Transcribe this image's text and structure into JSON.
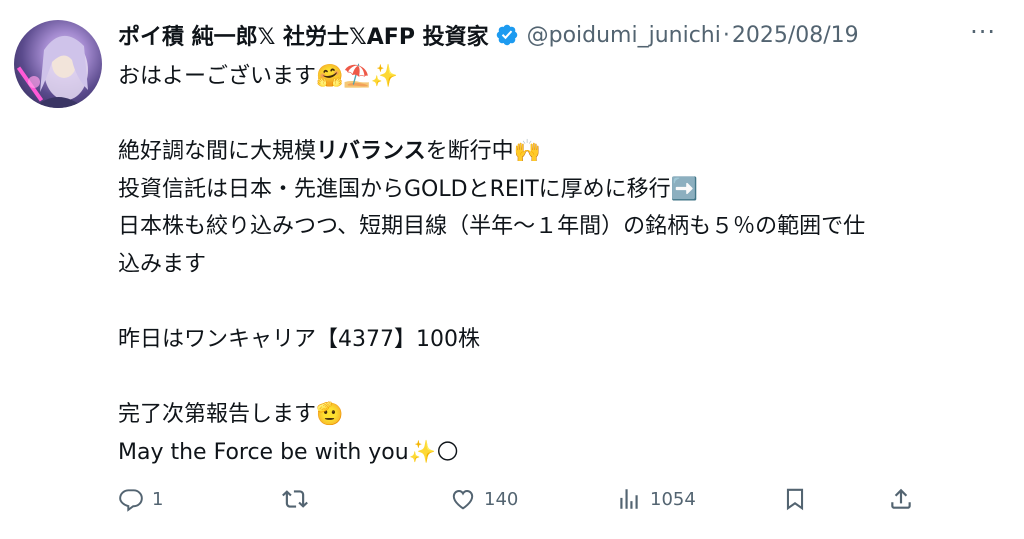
{
  "tweet": {
    "author": {
      "display_name": "ポイ積 純一郎𝕏 社労士𝕏AFP 投資家",
      "handle": "@poidumi_junichi",
      "separator": "·",
      "date": "2025/08/19",
      "verified": true
    },
    "lines": [
      {
        "text": "おはよーございます🤗⛱️✨"
      },
      {
        "blank": true
      },
      {
        "pre": "絶好調な間に大規模",
        "bold": "リバランス",
        "post": "を断行中🙌"
      },
      {
        "text": "投資信託は日本・先進国からGOLDとREITに厚めに移行➡️"
      },
      {
        "text": "日本株も絞り込みつつ、短期目線（半年〜１年間）の銘柄も５％の範囲で仕"
      },
      {
        "text": "込みます"
      },
      {
        "blank": true
      },
      {
        "text": "昨日はワンキャリア【4377】100株"
      },
      {
        "blank": true
      },
      {
        "text": "完了次第報告します🫡"
      },
      {
        "text": "May the Force be with you✨🌕"
      }
    ],
    "actions": {
      "reply": {
        "icon": "reply-icon",
        "count": "1"
      },
      "retweet": {
        "icon": "retweet-icon",
        "count": ""
      },
      "like": {
        "icon": "heart-icon",
        "count": "140"
      },
      "views": {
        "icon": "views-icon",
        "count": "1054"
      },
      "bookmark": {
        "icon": "bookmark-icon"
      },
      "share": {
        "icon": "share-icon"
      }
    },
    "more_label": "···",
    "colors": {
      "text": "#0f1419",
      "secondary": "#536471",
      "verified": "#1d9bf0"
    }
  }
}
